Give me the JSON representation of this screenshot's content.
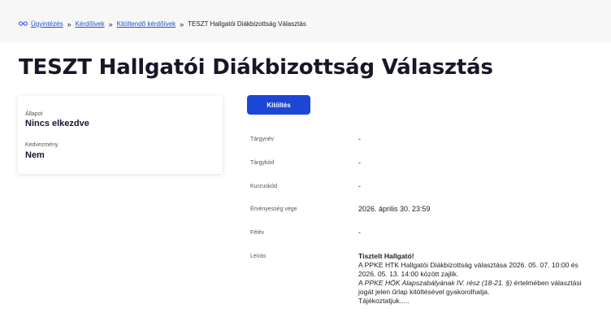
{
  "breadcrumb": {
    "home": "Ügyintézés",
    "forms": "Kérdőívek",
    "to_fill": "Kitöltendő kérdőívek",
    "current": "TESZT Hallgatói Diákbizottság Választás",
    "separator": "»"
  },
  "page": {
    "title": "TESZT Hallgatói Diákbizottság Választás"
  },
  "status_card": {
    "state_label": "Állapot",
    "state_value": "Nincs elkezdve",
    "benefit_label": "Kedvezmény",
    "benefit_value": "Nem"
  },
  "actions": {
    "fill_label": "Kitöltés"
  },
  "details": {
    "subject_name_label": "Tárgynév",
    "subject_name_value": "-",
    "subject_code_label": "Tárgykód",
    "subject_code_value": "-",
    "course_code_label": "Kurzuskód",
    "course_code_value": "-",
    "validity_end_label": "Érvényesség vége",
    "validity_end_value": "2026. április 30. 23:59",
    "semester_label": "Félév",
    "semester_value": "-",
    "description_label": "Leírás"
  },
  "description": {
    "greeting": "Tisztelt Hallgató!",
    "line1": "A PPKE HTK Hallgatói Diákbizottság választása 2026. 05. 07. 10:00 és",
    "line2": "2026. 05. 13. 14:00 között zajlik.",
    "line3_a": "A ",
    "line3_em": "PPKE HÖK Alapszabályának IV. rész (18-21. §)",
    "line3_b": " értelmében választási",
    "line4": "jogát jelen űrlap kitöltésével gyakorolhatja.",
    "line5": "Tájékoztatjuk....."
  },
  "colors": {
    "link": "#1e4fd8",
    "button": "#1d46d6",
    "title": "#17172a"
  },
  "icons": {
    "home": "glasses-icon"
  }
}
